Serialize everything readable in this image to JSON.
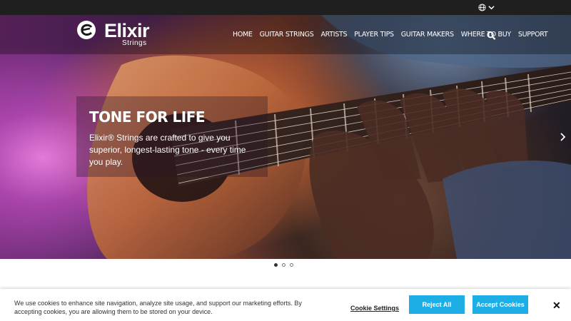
{
  "topbar": {
    "language_icon": "globe-icon",
    "language_dropdown_icon": "chevron-down-icon"
  },
  "brand": {
    "name": "Elixir",
    "sub": "Strings"
  },
  "nav": {
    "items": [
      {
        "label": "HOME"
      },
      {
        "label": "GUITAR STRINGS"
      },
      {
        "label": "ARTISTS"
      },
      {
        "label": "PLAYER TIPS"
      },
      {
        "label": "GUITAR MAKERS"
      },
      {
        "label": "WHERE TO BUY"
      },
      {
        "label": "SUPPORT"
      }
    ],
    "search_icon": "search-icon"
  },
  "hero": {
    "title": "TONE FOR LIFE",
    "text": "Elixir® Strings are crafted to give you superior, longest-lasting tone - every time you play.",
    "slides_total": 3,
    "active_slide": 1
  },
  "cookie": {
    "text": "We use cookies to enhance site navigation, analyze site usage, and support our marketing efforts. By accepting cookies, you are allowing them to be stored on your device.",
    "settings_label": "Cookie Settings",
    "reject_label": "Reject All",
    "accept_label": "Accept Cookies",
    "close_icon": "close-icon"
  },
  "colors": {
    "topbar": "#1f1f1f",
    "accent_button": "#1daee6"
  }
}
